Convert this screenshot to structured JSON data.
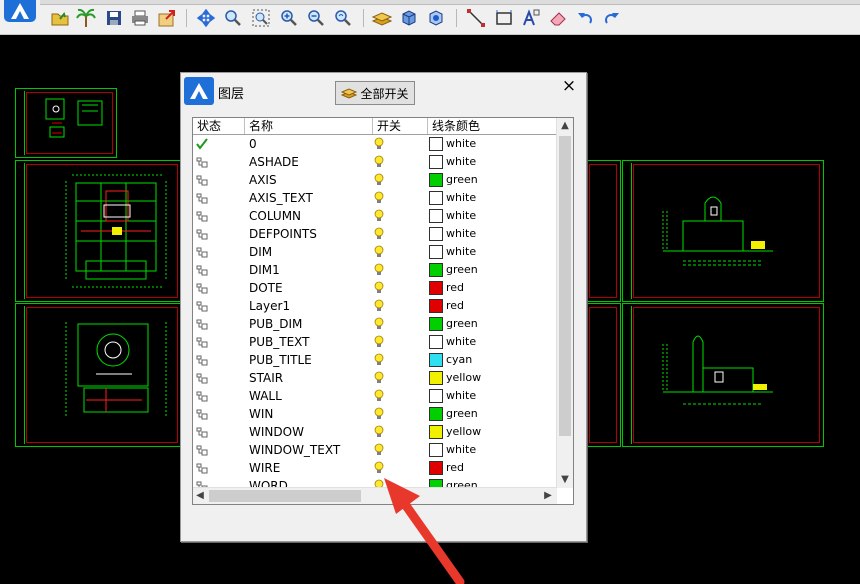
{
  "toolbar": {
    "icons": [
      "open-folder-icon",
      "palm-tree-icon",
      "save-icon",
      "print-icon",
      "export-icon",
      "pan-icon",
      "zoom-realtime-icon",
      "zoom-window-icon",
      "zoom-in-icon",
      "zoom-out-icon",
      "zoom-previous-icon",
      "layer-icon",
      "cube-icon",
      "3d-orbit-icon",
      "line-icon",
      "rectangle-icon",
      "text-icon",
      "eraser-icon",
      "undo-icon",
      "redo-icon"
    ]
  },
  "dialog": {
    "title": "图层",
    "all_toggle_label": "全部开关",
    "close_symbol": "×",
    "columns": {
      "status": "状态",
      "name": "名称",
      "toggle": "开关",
      "line_color": "线条颜色"
    },
    "layers": [
      {
        "name": "0",
        "color": "white",
        "hex": "#ffffff",
        "current": true
      },
      {
        "name": "ASHADE",
        "color": "white",
        "hex": "#ffffff",
        "current": false
      },
      {
        "name": "AXIS",
        "color": "green",
        "hex": "#00d000",
        "current": false
      },
      {
        "name": "AXIS_TEXT",
        "color": "white",
        "hex": "#ffffff",
        "current": false
      },
      {
        "name": "COLUMN",
        "color": "white",
        "hex": "#ffffff",
        "current": false
      },
      {
        "name": "DEFPOINTS",
        "color": "white",
        "hex": "#ffffff",
        "current": false
      },
      {
        "name": "DIM",
        "color": "white",
        "hex": "#ffffff",
        "current": false
      },
      {
        "name": "DIM1",
        "color": "green",
        "hex": "#00d000",
        "current": false
      },
      {
        "name": "DOTE",
        "color": "red",
        "hex": "#e00000",
        "current": false
      },
      {
        "name": "Layer1",
        "color": "red",
        "hex": "#e00000",
        "current": false
      },
      {
        "name": "PUB_DIM",
        "color": "green",
        "hex": "#00d000",
        "current": false
      },
      {
        "name": "PUB_TEXT",
        "color": "white",
        "hex": "#ffffff",
        "current": false
      },
      {
        "name": "PUB_TITLE",
        "color": "cyan",
        "hex": "#30e0f0",
        "current": false
      },
      {
        "name": "STAIR",
        "color": "yellow",
        "hex": "#f0f000",
        "current": false
      },
      {
        "name": "WALL",
        "color": "white",
        "hex": "#ffffff",
        "current": false
      },
      {
        "name": "WIN",
        "color": "green",
        "hex": "#00d000",
        "current": false
      },
      {
        "name": "WINDOW",
        "color": "yellow",
        "hex": "#f0f000",
        "current": false
      },
      {
        "name": "WINDOW_TEXT",
        "color": "white",
        "hex": "#ffffff",
        "current": false
      },
      {
        "name": "WIRE",
        "color": "red",
        "hex": "#e00000",
        "current": false
      },
      {
        "name": "WORD",
        "color": "green",
        "hex": "#00d000",
        "current": false
      }
    ]
  },
  "colors": {
    "accent": "#1f6fd8",
    "cad_background": "#000000",
    "sheet_border": "#00c800",
    "annotation_arrow": "#e8382c"
  }
}
